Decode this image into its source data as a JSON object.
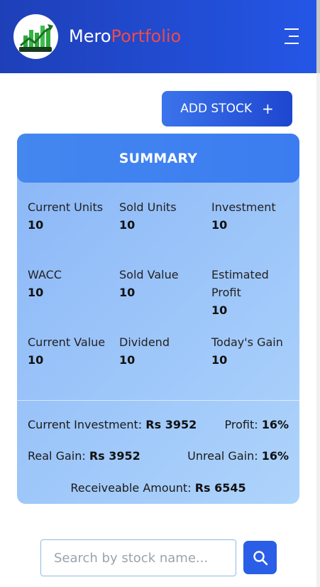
{
  "header": {
    "brand_part1": "Mero",
    "brand_part2": "Portfolio"
  },
  "actions": {
    "add_stock_label": "ADD STOCK",
    "add_stock_icon": "+"
  },
  "summary": {
    "title": "SUMMARY",
    "cells": [
      {
        "label": "Current Units",
        "value": "10"
      },
      {
        "label": "Sold Units",
        "value": "10"
      },
      {
        "label": "Investment",
        "value": "10"
      },
      {
        "label": "WACC",
        "value": "10"
      },
      {
        "label": "Sold Value",
        "value": "10"
      },
      {
        "label": "Estimated Profit",
        "value": "10"
      },
      {
        "label": "Current Value",
        "value": "10"
      },
      {
        "label": "Dividend",
        "value": "10"
      },
      {
        "label": "Today's Gain",
        "value": "10"
      }
    ],
    "current_investment_label": "Current Investment:",
    "current_investment_value": "Rs 3952",
    "profit_label": "Profit:",
    "profit_value": "16%",
    "real_gain_label": "Real Gain:",
    "real_gain_value": "Rs 3952",
    "unreal_gain_label": "Unreal Gain:",
    "unreal_gain_value": "16%",
    "receivable_label": "Receiveable Amount:",
    "receivable_value": "Rs 6545"
  },
  "search": {
    "placeholder": "Search by stock name..."
  },
  "icons": {
    "logo": "stock-chart-logo",
    "menu": "hamburger-menu-icon",
    "search": "search-icon"
  },
  "colors": {
    "header": "#2456e6",
    "brand_accent": "#f04a4a",
    "card_head": "#3b7cf0",
    "button": "#2a5ee6"
  }
}
